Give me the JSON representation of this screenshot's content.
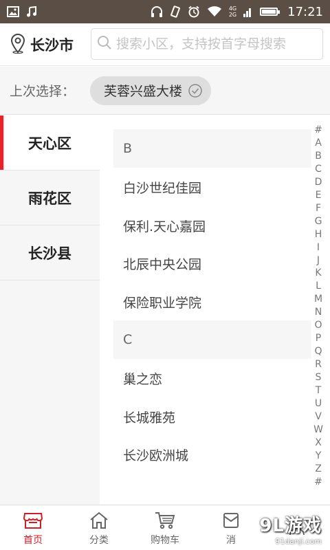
{
  "status_bar": {
    "time": "17:21",
    "network_label_top": "4G",
    "network_label_bottom": "2G",
    "battery_level": 0.9,
    "icons": [
      "image-icon",
      "music-icon",
      "headphones-icon",
      "vibrate-icon",
      "alarm-icon",
      "wifi-icon",
      "signal-icon",
      "battery-icon"
    ]
  },
  "header": {
    "city": "长沙市",
    "search_placeholder": "搜索小区，支持按首字母搜索"
  },
  "last_selection": {
    "label": "上次选择：",
    "value": "芙蓉兴盛大楼"
  },
  "districts": [
    {
      "label": "天心区",
      "active": true
    },
    {
      "label": "雨花区",
      "active": false
    },
    {
      "label": "长沙县",
      "active": false
    }
  ],
  "groups": [
    {
      "letter": "B",
      "items": [
        "白沙世纪佳园",
        "保利.天心嘉园",
        "北辰中央公园",
        "保险职业学院"
      ]
    },
    {
      "letter": "C",
      "items": [
        "巢之恋",
        "长城雅苑",
        "长沙欧洲城"
      ]
    }
  ],
  "alphabet": [
    "#",
    "A",
    "B",
    "C",
    "D",
    "E",
    "F",
    "G",
    "H",
    "I",
    "J",
    "K",
    "L",
    "M",
    "N",
    "O",
    "P",
    "Q",
    "R",
    "S",
    "T",
    "U",
    "V",
    "W",
    "X",
    "Y",
    "Z",
    "#"
  ],
  "tabs": [
    {
      "label": "首页",
      "icon": "store-icon",
      "active": true
    },
    {
      "label": "分类",
      "icon": "house-icon",
      "active": false
    },
    {
      "label": "购物车",
      "icon": "cart-icon",
      "active": false
    },
    {
      "label": "消",
      "icon": "message-icon",
      "active": false
    },
    {
      "label": "",
      "icon": "user-icon",
      "active": false
    }
  ],
  "watermark": {
    "main": "9L游戏",
    "sub": "91danji.com"
  },
  "colors": {
    "accent": "#e4232b",
    "tab_active": "#c8202a",
    "status_bar": "#5b4f45"
  }
}
